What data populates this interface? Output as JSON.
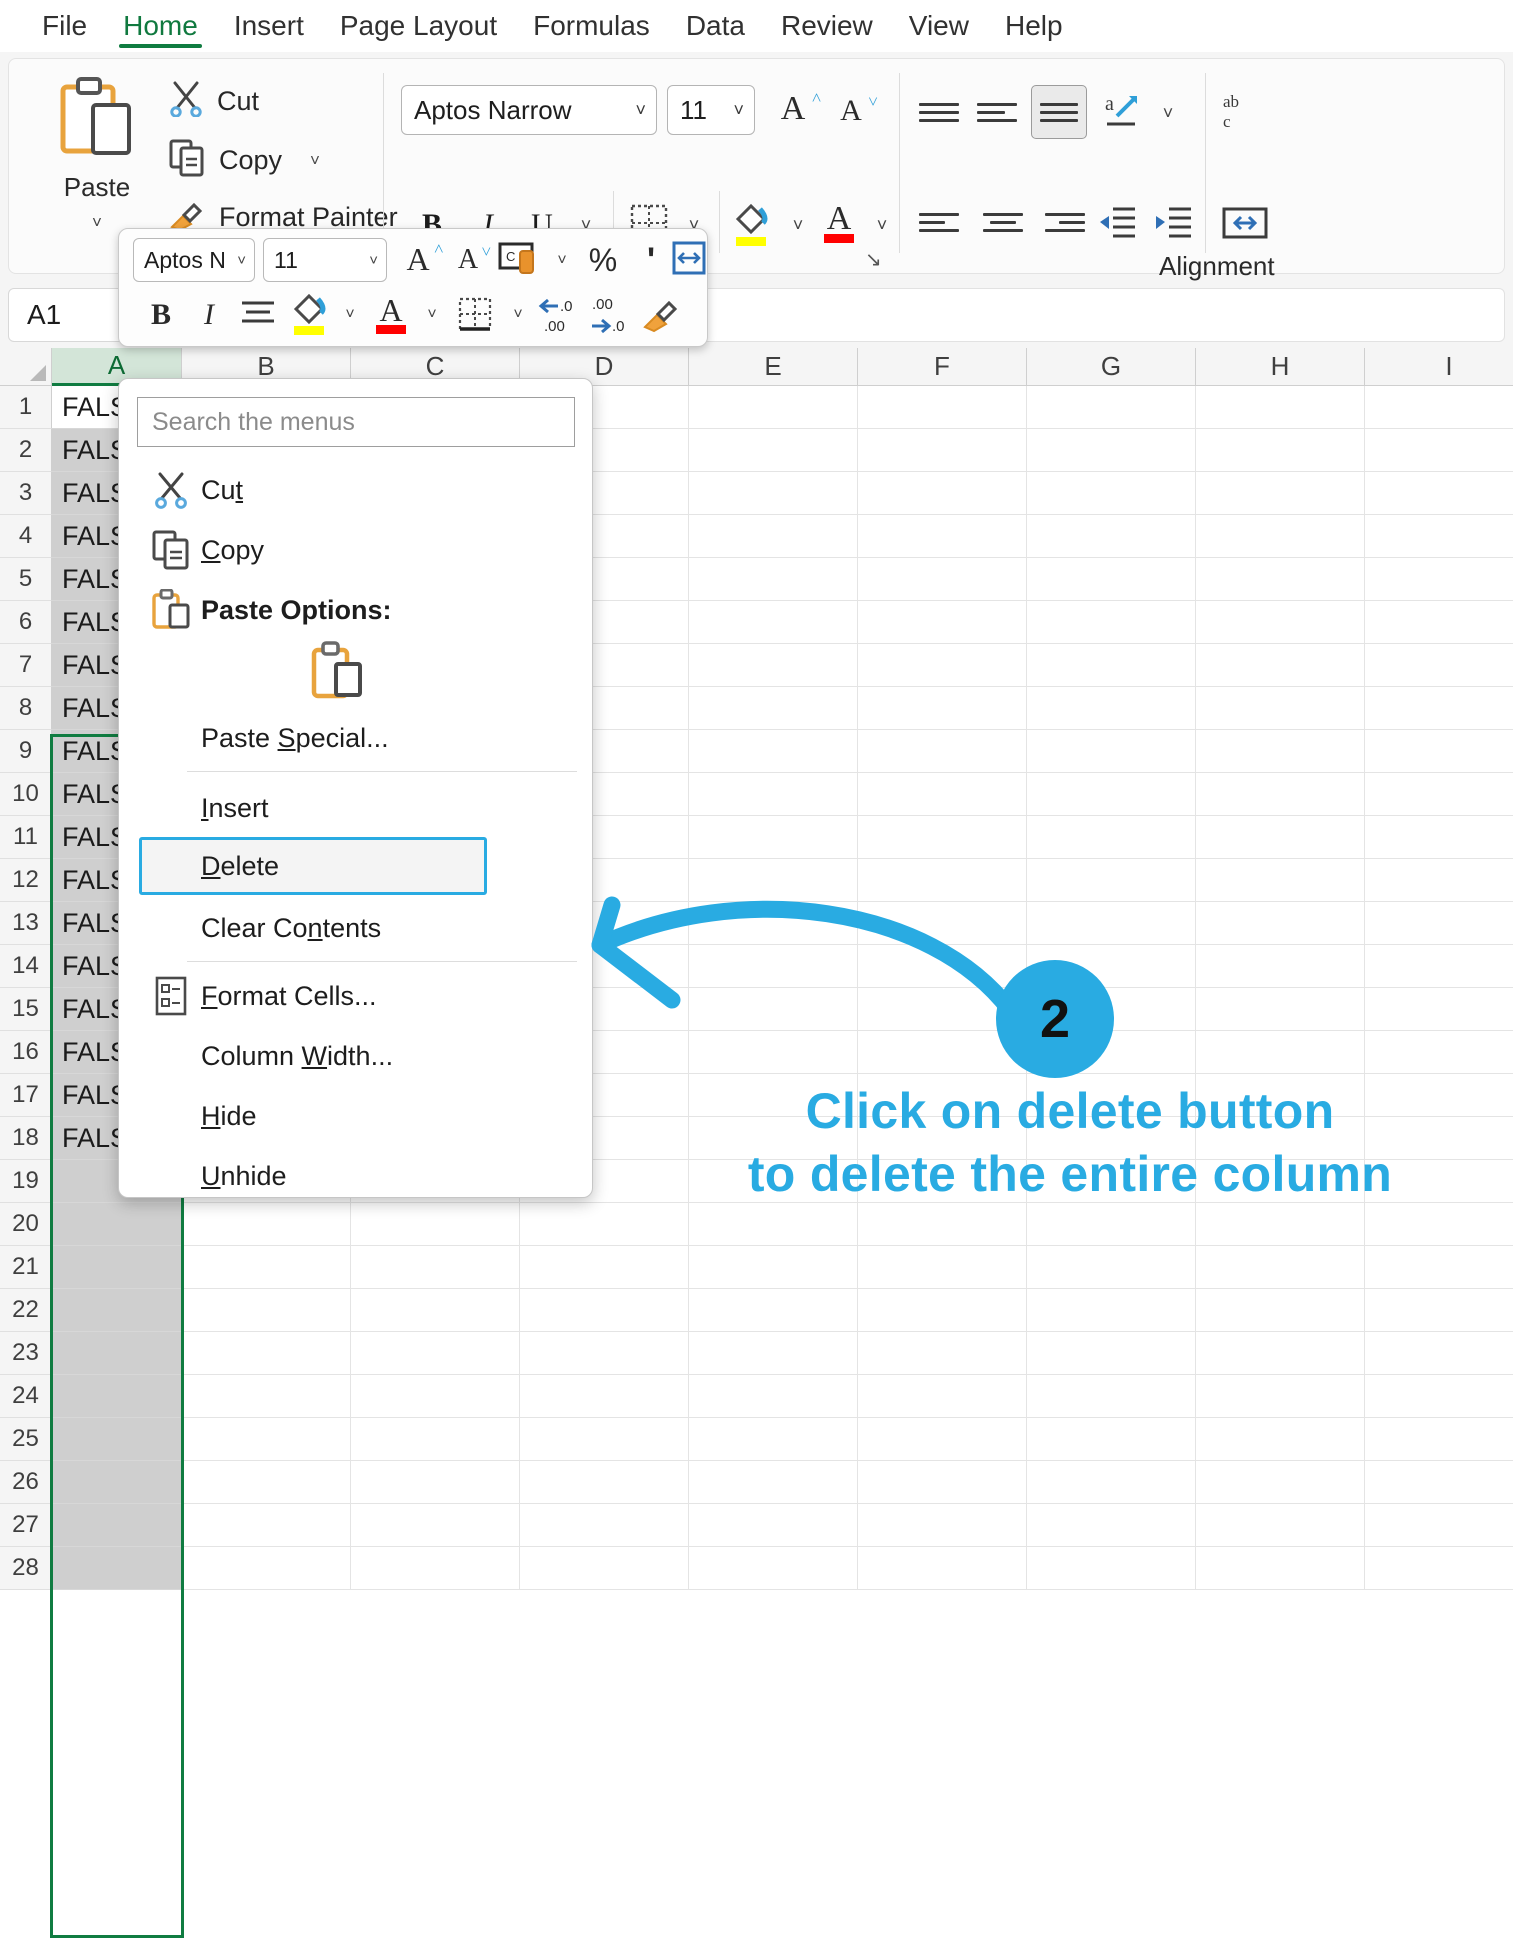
{
  "ribbon": {
    "tabs": [
      {
        "label": "File",
        "active": false
      },
      {
        "label": "Home",
        "active": true
      },
      {
        "label": "Insert",
        "active": false
      },
      {
        "label": "Page Layout",
        "active": false
      },
      {
        "label": "Formulas",
        "active": false
      },
      {
        "label": "Data",
        "active": false
      },
      {
        "label": "Review",
        "active": false
      },
      {
        "label": "View",
        "active": false
      },
      {
        "label": "Help",
        "active": false
      }
    ],
    "clipboard": {
      "paste_label": "Paste",
      "cut_label": "Cut",
      "copy_label": "Copy",
      "format_painter_label": "Format Painter"
    },
    "font": {
      "family_value": "Aptos Narrow",
      "size_value": "11",
      "bold_label": "B",
      "italic_label": "I",
      "underline_label": "U",
      "grow_font_label": "A",
      "shrink_font_label": "A",
      "highlight_color": "#ffff00",
      "font_color": "#ff0000"
    },
    "alignment": {
      "group_label": "Alignment"
    },
    "accent_color": "#107c41"
  },
  "formula_bar": {
    "name_box_value": "A1"
  },
  "sheet": {
    "columns": [
      "A",
      "B",
      "C",
      "D",
      "E",
      "F",
      "G",
      "H",
      "I"
    ],
    "selected_column": "A",
    "rows": [
      1,
      2,
      3,
      4,
      5,
      6,
      7,
      8,
      9,
      10,
      11,
      12,
      13,
      14,
      15,
      16,
      17,
      18,
      19,
      20,
      21,
      22,
      23,
      24,
      25,
      26,
      27,
      28
    ],
    "column_a_values": [
      "FALSE",
      "FALSE",
      "FALSE",
      "FALSE",
      "FALSE",
      "FALSE",
      "FALSE",
      "FALSE",
      "FALSE",
      "FALSE",
      "FALSE",
      "FALSE",
      "FALSE",
      "FALSE",
      "FALSE",
      "FALSE",
      "FALSE",
      "FALSE"
    ]
  },
  "mini_toolbar": {
    "font_family_value": "Aptos N",
    "font_size_value": "11",
    "grow_font_label": "A",
    "shrink_font_label": "A",
    "accounting_format_label": "accounting-format",
    "percent_label": "%",
    "comma_label": "'",
    "bold_label": "B",
    "italic_label": "I"
  },
  "context_menu": {
    "search_placeholder": "Search the menus",
    "items": [
      {
        "label": "Cut",
        "icon": "scissors-icon",
        "accel": "t"
      },
      {
        "label": "Copy",
        "icon": "copy-icon",
        "accel": "C"
      },
      {
        "label": "Paste Options:",
        "icon": "clipboard-icon",
        "bold": true
      },
      {
        "label": "Paste Special...",
        "icon": "",
        "accel": "S"
      },
      {
        "label": "Insert",
        "icon": "",
        "accel": "I"
      },
      {
        "label": "Delete",
        "icon": "",
        "accel": "D",
        "highlighted": true
      },
      {
        "label": "Clear Contents",
        "icon": "",
        "accel": "n"
      },
      {
        "label": "Format Cells...",
        "icon": "format-cells-icon",
        "accel": "F"
      },
      {
        "label": "Column Width...",
        "icon": "",
        "accel": "W"
      },
      {
        "label": "Hide",
        "icon": "",
        "accel": "H"
      },
      {
        "label": "Unhide",
        "icon": "",
        "accel": "U"
      }
    ]
  },
  "annotation": {
    "step_number": "2",
    "line1": "Click on delete button",
    "line2": "to delete the entire column",
    "color": "#29abe2"
  }
}
